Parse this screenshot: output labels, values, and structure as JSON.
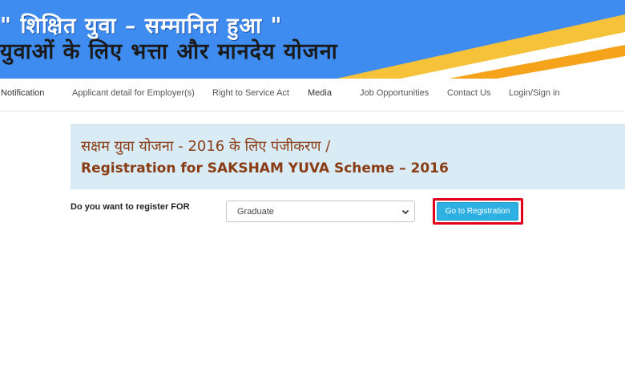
{
  "banner": {
    "line1": "\" शिक्षित युवा – सम्मानित हुआ \"",
    "line2": "युवाओं के लिए भत्ता और मानदेय योजना"
  },
  "nav": {
    "items": [
      "Notification",
      "Applicant detail for Employer(s)",
      "Right to Service Act",
      "Media",
      "Job Opportunities",
      "Contact Us",
      "Login/Sign in"
    ]
  },
  "page": {
    "title_hindi": "सक्षम युवा योजना - 2016 के लिए पंजीकरण /",
    "title_english": "Registration for SAKSHAM YUVA Scheme – 2016"
  },
  "form": {
    "label": "Do you want to register FOR",
    "select_value": "Graduate",
    "button_label": "Go to Registration"
  },
  "colors": {
    "banner_blue": "#3f8cf0",
    "title_brown": "#8a3d14",
    "title_box": "#d9ebf5",
    "button_blue": "#2eb0e3",
    "highlight_red": "#e0001b"
  },
  "icons": {
    "select_arrow": "chevron-down-icon"
  }
}
